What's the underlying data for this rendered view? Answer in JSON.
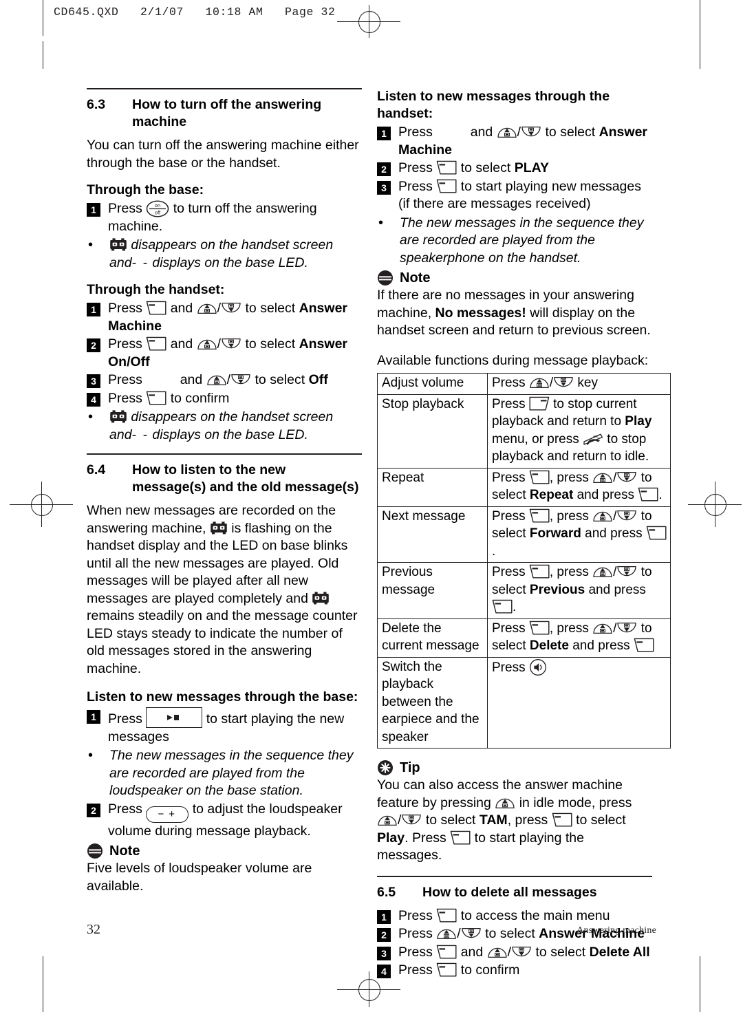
{
  "header": {
    "slug": "CD645.QXD   2/1/07   10:18 AM   Page 32"
  },
  "footer": {
    "page_number": "32",
    "section_title": "Answering machine"
  },
  "left_column": {
    "section_63": {
      "number": "6.3",
      "title": "How to turn off the answering machine",
      "intro": "You can turn off the answering machine either through the base or the handset.",
      "through_base_heading": "Through the base:",
      "base_steps": [
        {
          "n": "1",
          "before": "Press",
          "icon": "onoff-key-icon",
          "after": "to turn off the answering machine."
        }
      ],
      "base_bullet": {
        "icon": "answering-machine-tape-icon",
        "text_a": "disappears on the handset screen and",
        "dashes": "- -",
        "text_b": "displays on the base LED."
      },
      "through_handset_heading": "Through the handset:",
      "handset_steps": [
        {
          "n": "1",
          "before": "Press",
          "icon1": "left-soft-key-icon",
          "mid": "and",
          "icon2": "up-down-nav-key-icon",
          "after": "to select",
          "bold": "Answer Machine"
        },
        {
          "n": "2",
          "before": "Press",
          "icon1": "left-soft-key-icon",
          "mid": "and",
          "icon2": "up-down-nav-key-icon",
          "after": "to select",
          "bold": "Answer On/Off"
        },
        {
          "n": "3",
          "before": "Press",
          "icon1": "",
          "mid": "and",
          "icon2": "up-down-nav-key-icon",
          "after": "to select",
          "bold": "Off"
        },
        {
          "n": "4",
          "before": "Press",
          "icon1": "left-soft-key-icon",
          "mid": "",
          "icon2": "",
          "after": "to confirm",
          "bold": ""
        }
      ],
      "handset_bullet": {
        "icon": "answering-machine-tape-icon",
        "text_a": "disappears on the handset screen and",
        "dashes": "- -",
        "text_b": "displays on the base LED."
      }
    },
    "section_64": {
      "number": "6.4",
      "title": "How to listen to the new message(s) and the old message(s)",
      "body_1": "When new messages are recorded on the answering machine,",
      "body_2": "is flashing on the handset display and the LED on base blinks until all the new messages are played.  Old messages will be played after all new messages are played completely and",
      "body_3": "remains steadily on and the message counter LED stays steady to indicate the number of old messages stored in the answering machine.",
      "listen_base_heading": "Listen to new messages through the base:",
      "steps": [
        {
          "n": "1",
          "before": "Press",
          "icon": "base-play-stop-button-icon",
          "after": "to start playing the new messages"
        },
        {
          "n": "2",
          "before": "Press",
          "icon": "base-volume-key-icon",
          "after": "to adjust the loudspeaker volume during message playback."
        }
      ],
      "bullet": "The new messages in the sequence they are recorded are played from the loudspeaker on the base station.",
      "note_label": "Note",
      "note_text": "Five levels of loudspeaker volume are available."
    }
  },
  "right_column": {
    "listen_handset_heading": "Listen to new messages through the handset:",
    "handset_steps": [
      {
        "n": "1",
        "before": "Press",
        "icon1": "",
        "mid": "and",
        "icon2": "up-down-nav-key-icon",
        "after": "to select",
        "bold": "Answer Machine",
        "tail": ""
      },
      {
        "n": "2",
        "before": "Press",
        "icon1": "left-soft-key-icon",
        "mid": "",
        "icon2": "",
        "after": "to select",
        "bold": "PLAY",
        "tail": ""
      },
      {
        "n": "3",
        "before": "Press",
        "icon1": "left-soft-key-icon",
        "mid": "",
        "icon2": "",
        "after": "to start playing new messages (if there are messages received)",
        "bold": "",
        "tail": ""
      }
    ],
    "handset_bullet": "The new messages in the sequence they are recorded are played from the speakerphone on the handset.",
    "note_label": "Note",
    "note_text_a": "If there are no messages in your answering machine,",
    "note_bold": "No messages!",
    "note_text_b": "will display on the handset screen and return to previous screen.",
    "table_caption": "Available functions during message playback:",
    "table": {
      "rows": [
        {
          "key": "Adjust volume",
          "value_parts": [
            {
              "t": "text",
              "v": "Press"
            },
            {
              "t": "icon",
              "v": "up-down-nav-key-icon"
            },
            {
              "t": "text",
              "v": "key"
            }
          ]
        },
        {
          "key": "Stop playback",
          "value_parts": [
            {
              "t": "text",
              "v": "Press"
            },
            {
              "t": "icon",
              "v": "right-soft-key-icon"
            },
            {
              "t": "text",
              "v": "to stop current playback and return to"
            },
            {
              "t": "bold",
              "v": "Play"
            },
            {
              "t": "text",
              "v": "menu, or press"
            },
            {
              "t": "icon",
              "v": "hangup-key-icon"
            },
            {
              "t": "text",
              "v": "to stop playback and return to idle."
            }
          ]
        },
        {
          "key": "Repeat",
          "value_parts": [
            {
              "t": "text",
              "v": "Press"
            },
            {
              "t": "icon",
              "v": "left-soft-key-icon"
            },
            {
              "t": "text",
              "v": ", press"
            },
            {
              "t": "icon",
              "v": "up-down-nav-key-icon"
            },
            {
              "t": "text",
              "v": "to select"
            },
            {
              "t": "bold",
              "v": "Repeat"
            },
            {
              "t": "text",
              "v": "and press"
            },
            {
              "t": "icon",
              "v": "left-soft-key-icon"
            },
            {
              "t": "text",
              "v": "."
            }
          ]
        },
        {
          "key": "Next message",
          "value_parts": [
            {
              "t": "text",
              "v": "Press"
            },
            {
              "t": "icon",
              "v": "left-soft-key-icon"
            },
            {
              "t": "text",
              "v": ", press"
            },
            {
              "t": "icon",
              "v": "up-down-nav-key-icon"
            },
            {
              "t": "text",
              "v": "to select"
            },
            {
              "t": "bold",
              "v": "Forward"
            },
            {
              "t": "text",
              "v": "and press"
            },
            {
              "t": "icon",
              "v": "left-soft-key-icon"
            },
            {
              "t": "text",
              "v": "."
            }
          ]
        },
        {
          "key": "Previous message",
          "value_parts": [
            {
              "t": "text",
              "v": "Press"
            },
            {
              "t": "icon",
              "v": "left-soft-key-icon"
            },
            {
              "t": "text",
              "v": ", press"
            },
            {
              "t": "icon",
              "v": "up-down-nav-key-icon"
            },
            {
              "t": "text",
              "v": "to select"
            },
            {
              "t": "bold",
              "v": "Previous"
            },
            {
              "t": "text",
              "v": " and press"
            },
            {
              "t": "icon",
              "v": "left-soft-key-icon"
            },
            {
              "t": "text",
              "v": "."
            }
          ]
        },
        {
          "key": "Delete the current message",
          "value_parts": [
            {
              "t": "text",
              "v": "Press"
            },
            {
              "t": "icon",
              "v": "left-soft-key-icon"
            },
            {
              "t": "text",
              "v": ", press"
            },
            {
              "t": "icon",
              "v": "up-down-nav-key-icon"
            },
            {
              "t": "text",
              "v": "to select"
            },
            {
              "t": "bold",
              "v": "Delete"
            },
            {
              "t": "text",
              "v": "and press"
            },
            {
              "t": "icon",
              "v": "left-soft-key-icon"
            }
          ]
        },
        {
          "key": "Switch the playback between the earpiece and the speaker",
          "value_parts": [
            {
              "t": "text",
              "v": "Press"
            },
            {
              "t": "icon",
              "v": "speaker-key-icon"
            }
          ]
        }
      ]
    },
    "tip_label": "Tip",
    "tip_parts": [
      {
        "t": "text",
        "v": "You can also access the answer machine feature by pressing"
      },
      {
        "t": "icon",
        "v": "up-nav-key-icon"
      },
      {
        "t": "text",
        "v": "in idle mode, press"
      },
      {
        "t": "icon",
        "v": "up-down-nav-key-icon"
      },
      {
        "t": "text",
        "v": "to select"
      },
      {
        "t": "bold",
        "v": "TAM"
      },
      {
        "t": "text",
        "v": ", press"
      },
      {
        "t": "icon",
        "v": "left-soft-key-icon"
      },
      {
        "t": "text",
        "v": "to select"
      },
      {
        "t": "bold",
        "v": "Play"
      },
      {
        "t": "text",
        "v": ". Press"
      },
      {
        "t": "icon",
        "v": "left-soft-key-icon"
      },
      {
        "t": "text",
        "v": "to start playing the messages."
      }
    ],
    "section_65": {
      "number": "6.5",
      "title": "How to delete all messages",
      "steps": [
        {
          "n": "1",
          "before": "Press",
          "icon1": "left-soft-key-icon",
          "mid": "",
          "icon2": "",
          "after": "to access the main menu",
          "bold": ""
        },
        {
          "n": "2",
          "before": "Press",
          "icon1": "up-down-nav-key-icon",
          "mid": "",
          "icon2": "",
          "after": "to select",
          "bold": "Answer Machine"
        },
        {
          "n": "3",
          "before": "Press",
          "icon1": "left-soft-key-icon",
          "mid": "and",
          "icon2": "up-down-nav-key-icon",
          "after": "to select",
          "bold": "Delete All"
        },
        {
          "n": "4",
          "before": "Press",
          "icon1": "left-soft-key-icon",
          "mid": "",
          "icon2": "",
          "after": "to confirm",
          "bold": ""
        }
      ]
    }
  },
  "colors": {
    "ink": "#231f20",
    "badge_bg": "#000000",
    "badge_fg": "#ffffff"
  }
}
